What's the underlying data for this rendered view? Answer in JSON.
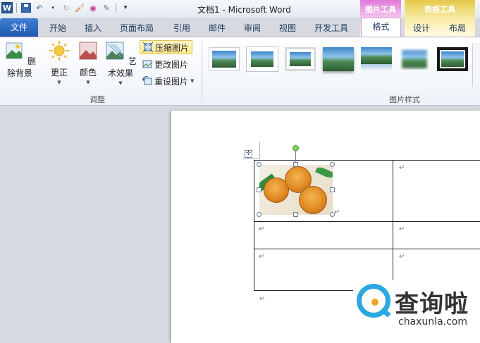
{
  "window": {
    "title": "文档1 - Microsoft Word"
  },
  "quick_access": {
    "app_icon": "word-icon",
    "items": [
      "save-icon",
      "undo-icon",
      "redo-icon",
      "format-painter-icon",
      "color-icon",
      "pen-icon",
      "customize-icon"
    ]
  },
  "context_groups": {
    "picture_tools": "图片工具",
    "table_tools": "表格工具"
  },
  "tabs": {
    "file": "文件",
    "items": [
      "开始",
      "插入",
      "页面布局",
      "引用",
      "邮件",
      "审阅",
      "视图",
      "开发工具"
    ],
    "picture_format": "格式",
    "table_design": "设计",
    "table_layout": "布局"
  },
  "ribbon": {
    "adjust": {
      "label": "调整",
      "remove_background": "删除背景",
      "corrections": "更正",
      "color": "颜色",
      "artistic_effects": "艺术效果",
      "compress": "压缩图片",
      "change": "更改图片",
      "reset": "重设图片"
    },
    "picture_styles": {
      "label": "图片样式"
    }
  },
  "document": {
    "paragraph_mark": "↵"
  },
  "watermark": {
    "name_cn": "查询啦",
    "name_en": "chaxunla.com"
  },
  "colors": {
    "file_tab": "#2b5fb8",
    "picture_tools": "#e07bd8",
    "table_tools": "#e5c84a",
    "watermark_blue": "#2aa8df",
    "watermark_orange": "#f3a21b"
  }
}
